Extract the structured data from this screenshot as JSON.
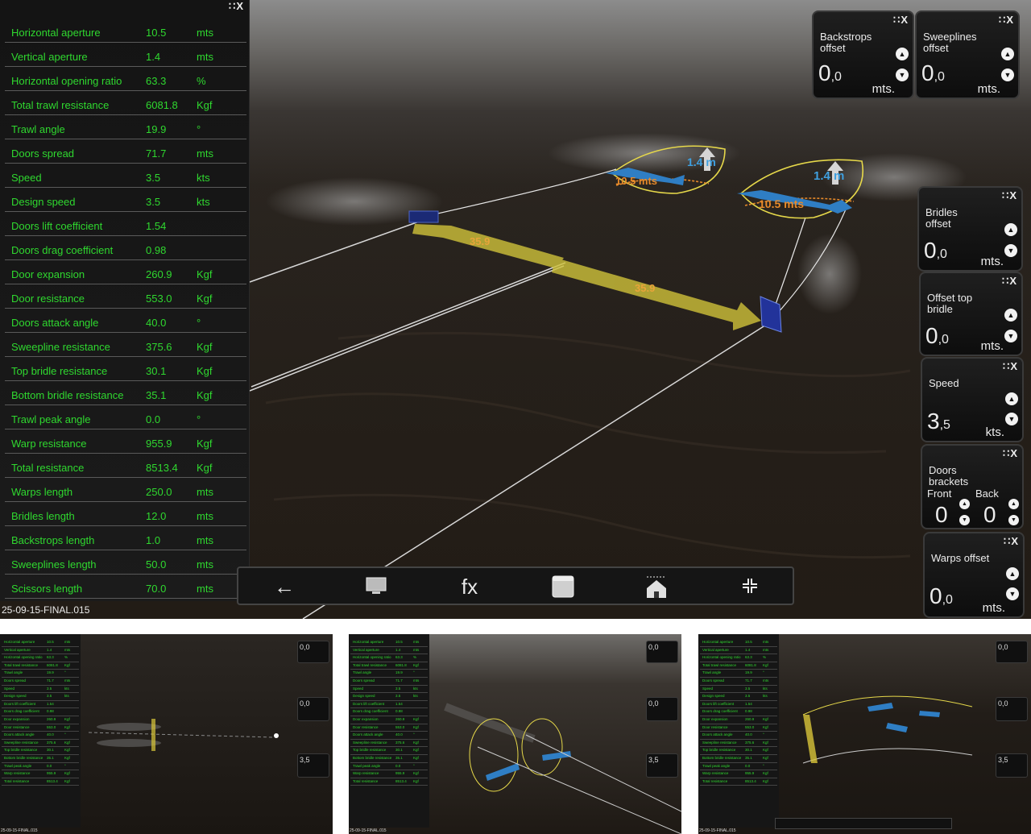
{
  "panel": {
    "controls": "∷X",
    "rows": [
      {
        "name": "Horizontal aperture",
        "value": "10.5",
        "unit": "mts"
      },
      {
        "name": "Vertical aperture",
        "value": "1.4",
        "unit": "mts"
      },
      {
        "name": "Horizontal opening ratio",
        "value": "63.3",
        "unit": "%"
      },
      {
        "name": "Total trawl resistance",
        "value": "6081.8",
        "unit": "Kgf"
      },
      {
        "name": "Trawl angle",
        "value": "19.9",
        "unit": "°"
      },
      {
        "name": "Doors spread",
        "value": "71.7",
        "unit": "mts"
      },
      {
        "name": "Speed",
        "value": "3.5",
        "unit": "kts"
      },
      {
        "name": "Design speed",
        "value": "3.5",
        "unit": "kts"
      },
      {
        "name": "Doors lift coefficient",
        "value": "1.54",
        "unit": ""
      },
      {
        "name": "Doors drag coefficient",
        "value": "0.98",
        "unit": ""
      },
      {
        "name": "Door expansion",
        "value": "260.9",
        "unit": "Kgf"
      },
      {
        "name": "Door resistance",
        "value": "553.0",
        "unit": "Kgf"
      },
      {
        "name": "Doors attack angle",
        "value": "40.0",
        "unit": "°"
      },
      {
        "name": "Sweepline resistance",
        "value": "375.6",
        "unit": "Kgf"
      },
      {
        "name": "Top bridle resistance",
        "value": "30.1",
        "unit": "Kgf"
      },
      {
        "name": "Bottom bridle resistance",
        "value": "35.1",
        "unit": "Kgf"
      },
      {
        "name": "Trawl peak angle",
        "value": "0.0",
        "unit": "°"
      },
      {
        "name": "Warp resistance",
        "value": "955.9",
        "unit": "Kgf"
      },
      {
        "name": "Total resistance",
        "value": "8513.4",
        "unit": "Kgf"
      },
      {
        "name": "Warps length",
        "value": "250.0",
        "unit": "mts"
      },
      {
        "name": "Bridles length",
        "value": "12.0",
        "unit": "mts"
      },
      {
        "name": "Backstrops length",
        "value": "1.0",
        "unit": "mts"
      },
      {
        "name": "Sweeplines length",
        "value": "50.0",
        "unit": "mts"
      },
      {
        "name": "Scissors length",
        "value": "70.0",
        "unit": "mts"
      }
    ]
  },
  "file_label": "25-09-15-FINAL.015",
  "scene": {
    "door_distance_left": "35.9",
    "door_distance_right": "35.9",
    "aperture_h_1": "10.5 mts",
    "aperture_v_1": "1.4 m",
    "aperture_h_2": "10.5 mts",
    "aperture_v_2": "1.4 m"
  },
  "widgets": {
    "controls": "∷X",
    "backstrops": {
      "title": "Backstrops\noffset",
      "int": "0",
      "dec": ",0",
      "unit": "mts."
    },
    "sweeplines": {
      "title": "Sweeplines\noffset",
      "int": "0",
      "dec": ",0",
      "unit": "mts."
    },
    "bridles": {
      "title": "Bridles\noffset",
      "int": "0",
      "dec": ",0",
      "unit": "mts."
    },
    "offset_top_bridle": {
      "title": "Offset top\nbridle",
      "int": "0",
      "dec": ",0",
      "unit": "mts."
    },
    "speed": {
      "title": "Speed",
      "int": "3",
      "dec": ",5",
      "unit": "kts."
    },
    "doors_brackets": {
      "title": "Doors\nbrackets",
      "front_label": "Front",
      "back_label": "Back",
      "front_value": "0",
      "back_value": "0"
    },
    "warps_offset": {
      "title": "Warps offset",
      "int": "0",
      "dec": ",0",
      "unit": "mts."
    }
  },
  "toolbar": {
    "back_icon": "←",
    "fx_label": "fx"
  },
  "thumbnails": {
    "file_label": "25-09-15-FINAL.015",
    "short_rows": [
      {
        "name": "Horizontal aperture",
        "value": "10.5",
        "unit": "mts"
      },
      {
        "name": "Vertical aperture",
        "value": "1.4",
        "unit": "mts"
      },
      {
        "name": "Horizontal opening ratio",
        "value": "63.3",
        "unit": "%"
      },
      {
        "name": "Total trawl resistance",
        "value": "6081.8",
        "unit": "Kgf"
      },
      {
        "name": "Trawl angle",
        "value": "19.9",
        "unit": "°"
      },
      {
        "name": "Doors spread",
        "value": "71.7",
        "unit": "mts"
      },
      {
        "name": "Speed",
        "value": "3.5",
        "unit": "kts"
      },
      {
        "name": "Design speed",
        "value": "3.5",
        "unit": "kts"
      },
      {
        "name": "Doors lift coefficient",
        "value": "1.54",
        "unit": ""
      },
      {
        "name": "Doors drag coefficient",
        "value": "0.98",
        "unit": ""
      },
      {
        "name": "Door expansion",
        "value": "260.9",
        "unit": "Kgf"
      },
      {
        "name": "Door resistance",
        "value": "553.0",
        "unit": "Kgf"
      },
      {
        "name": "Doors attack angle",
        "value": "40.0",
        "unit": "°"
      },
      {
        "name": "Sweepline resistance",
        "value": "375.6",
        "unit": "Kgf"
      },
      {
        "name": "Top bridle resistance",
        "value": "30.1",
        "unit": "Kgf"
      },
      {
        "name": "Bottom bridle resistance",
        "value": "35.1",
        "unit": "Kgf"
      },
      {
        "name": "Trawl peak angle",
        "value": "0.0",
        "unit": "°"
      },
      {
        "name": "Warp resistance",
        "value": "955.9",
        "unit": "Kgf"
      },
      {
        "name": "Total resistance",
        "value": "8513.4",
        "unit": "Kgf"
      }
    ]
  }
}
